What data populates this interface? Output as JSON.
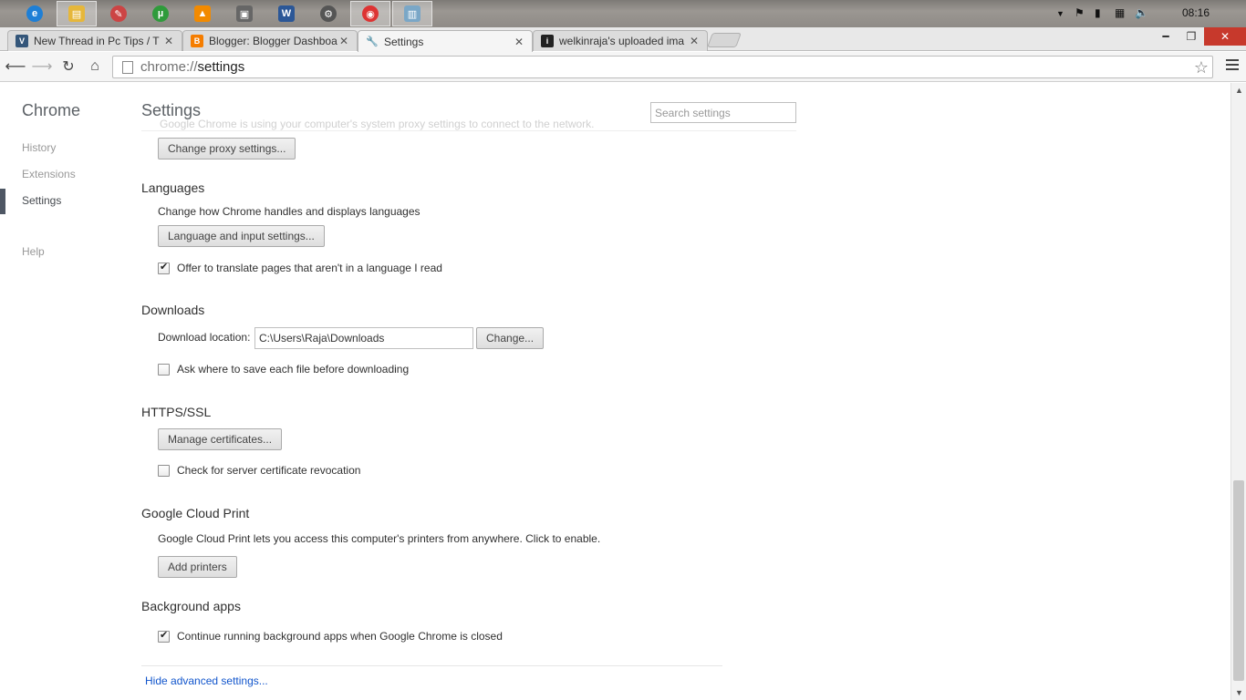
{
  "taskbar": {
    "icons": [
      {
        "name": "internet-explorer-icon",
        "glyph": "e",
        "color": "#1e7fd6"
      },
      {
        "name": "file-explorer-icon",
        "glyph": "▤",
        "color": "#e6b73b"
      },
      {
        "name": "paint-icon",
        "glyph": "✎",
        "color": "#c44"
      },
      {
        "name": "utorrent-icon",
        "glyph": "µ",
        "color": "#2f9b3b"
      },
      {
        "name": "vlc-icon",
        "glyph": "▲",
        "color": "#f28a00"
      },
      {
        "name": "media-icon",
        "glyph": "▣",
        "color": "#666"
      },
      {
        "name": "word-icon",
        "glyph": "W",
        "color": "#2b5797"
      },
      {
        "name": "settings-gear-icon",
        "glyph": "⚙",
        "color": "#555"
      },
      {
        "name": "chrome-icon",
        "glyph": "◉",
        "color": "#d33"
      },
      {
        "name": "notepad-icon",
        "glyph": "▥",
        "color": "#7aa7c7"
      }
    ],
    "clock": "08:16"
  },
  "tabs": [
    {
      "title": "New Thread in Pc Tips / T",
      "favicon": "V",
      "color": "#34567a",
      "active": false
    },
    {
      "title": "Blogger: Blogger Dashboa",
      "favicon": "B",
      "color": "#f57d00",
      "active": false
    },
    {
      "title": "Settings",
      "favicon": "🔧",
      "color": "#777",
      "active": true
    },
    {
      "title": "welkinraja's uploaded ima",
      "favicon": "i",
      "color": "#222",
      "active": false
    }
  ],
  "omnibox": {
    "scheme": "chrome://",
    "host": "settings"
  },
  "sidenav": {
    "brand": "Chrome",
    "items": [
      "History",
      "Extensions",
      "Settings",
      "Help"
    ]
  },
  "header": {
    "title": "Settings",
    "search_placeholder": "Search settings",
    "faded_text": "Google Chrome is using your computer's system proxy settings to connect to the network."
  },
  "proxy": {
    "button": "Change proxy settings..."
  },
  "languages": {
    "title": "Languages",
    "description": "Change how Chrome handles and displays languages",
    "button": "Language and input settings...",
    "translate_label": "Offer to translate pages that aren't in a language I read",
    "translate_checked": true
  },
  "downloads": {
    "title": "Downloads",
    "location_label": "Download location:",
    "location_value": "C:\\Users\\Raja\\Downloads",
    "change_button": "Change...",
    "ask_label": "Ask where to save each file before downloading",
    "ask_checked": false
  },
  "https": {
    "title": "HTTPS/SSL",
    "button": "Manage certificates...",
    "revocation_label": "Check for server certificate revocation",
    "revocation_checked": false
  },
  "cloud_print": {
    "title": "Google Cloud Print",
    "description": "Google Cloud Print lets you access this computer's printers from anywhere. Click to enable.",
    "button": "Add printers"
  },
  "background_apps": {
    "title": "Background apps",
    "label": "Continue running background apps when Google Chrome is closed",
    "checked": true
  },
  "footer": {
    "hide_advanced": "Hide advanced settings..."
  }
}
